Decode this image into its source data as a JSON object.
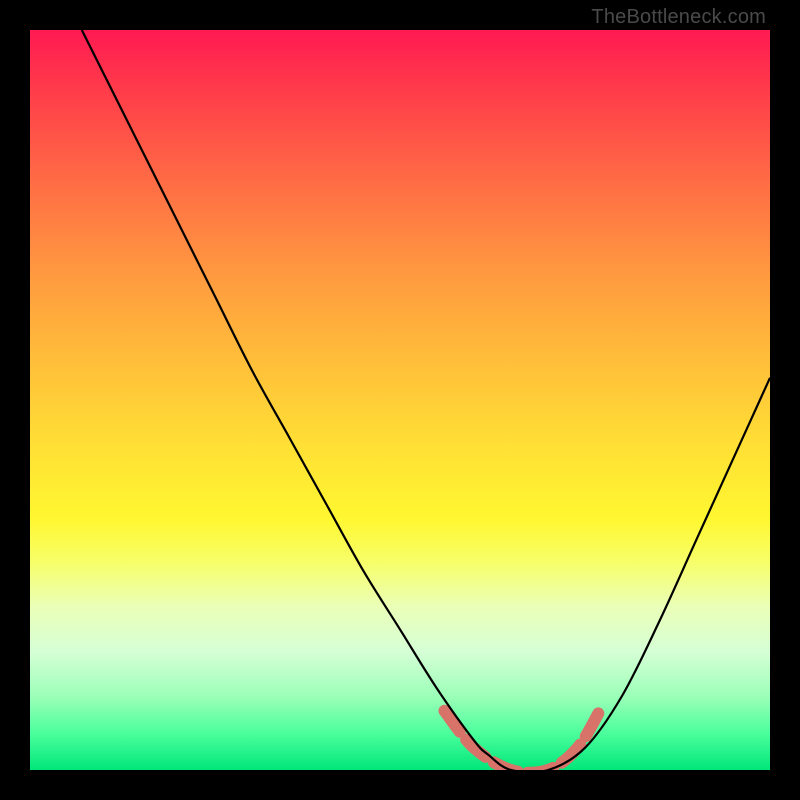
{
  "attribution": "TheBottleneck.com",
  "chart_data": {
    "type": "line",
    "title": "",
    "xlabel": "",
    "ylabel": "",
    "xlim": [
      0,
      100
    ],
    "ylim": [
      0,
      100
    ],
    "series": [
      {
        "name": "bottleneck-curve",
        "x": [
          7,
          10,
          15,
          20,
          25,
          30,
          35,
          40,
          45,
          50,
          55,
          60,
          62,
          65,
          70,
          75,
          80,
          85,
          90,
          95,
          100
        ],
        "y": [
          100,
          94,
          84,
          74,
          64,
          54,
          45,
          36,
          27,
          19,
          11,
          4,
          2,
          0,
          0,
          3,
          10,
          20,
          31,
          42,
          53
        ]
      }
    ],
    "accent_segment": {
      "name": "optimal-range-marker",
      "x": [
        56,
        60,
        65,
        70,
        74,
        77
      ],
      "y": [
        8,
        3,
        0,
        0,
        3,
        8
      ]
    }
  }
}
